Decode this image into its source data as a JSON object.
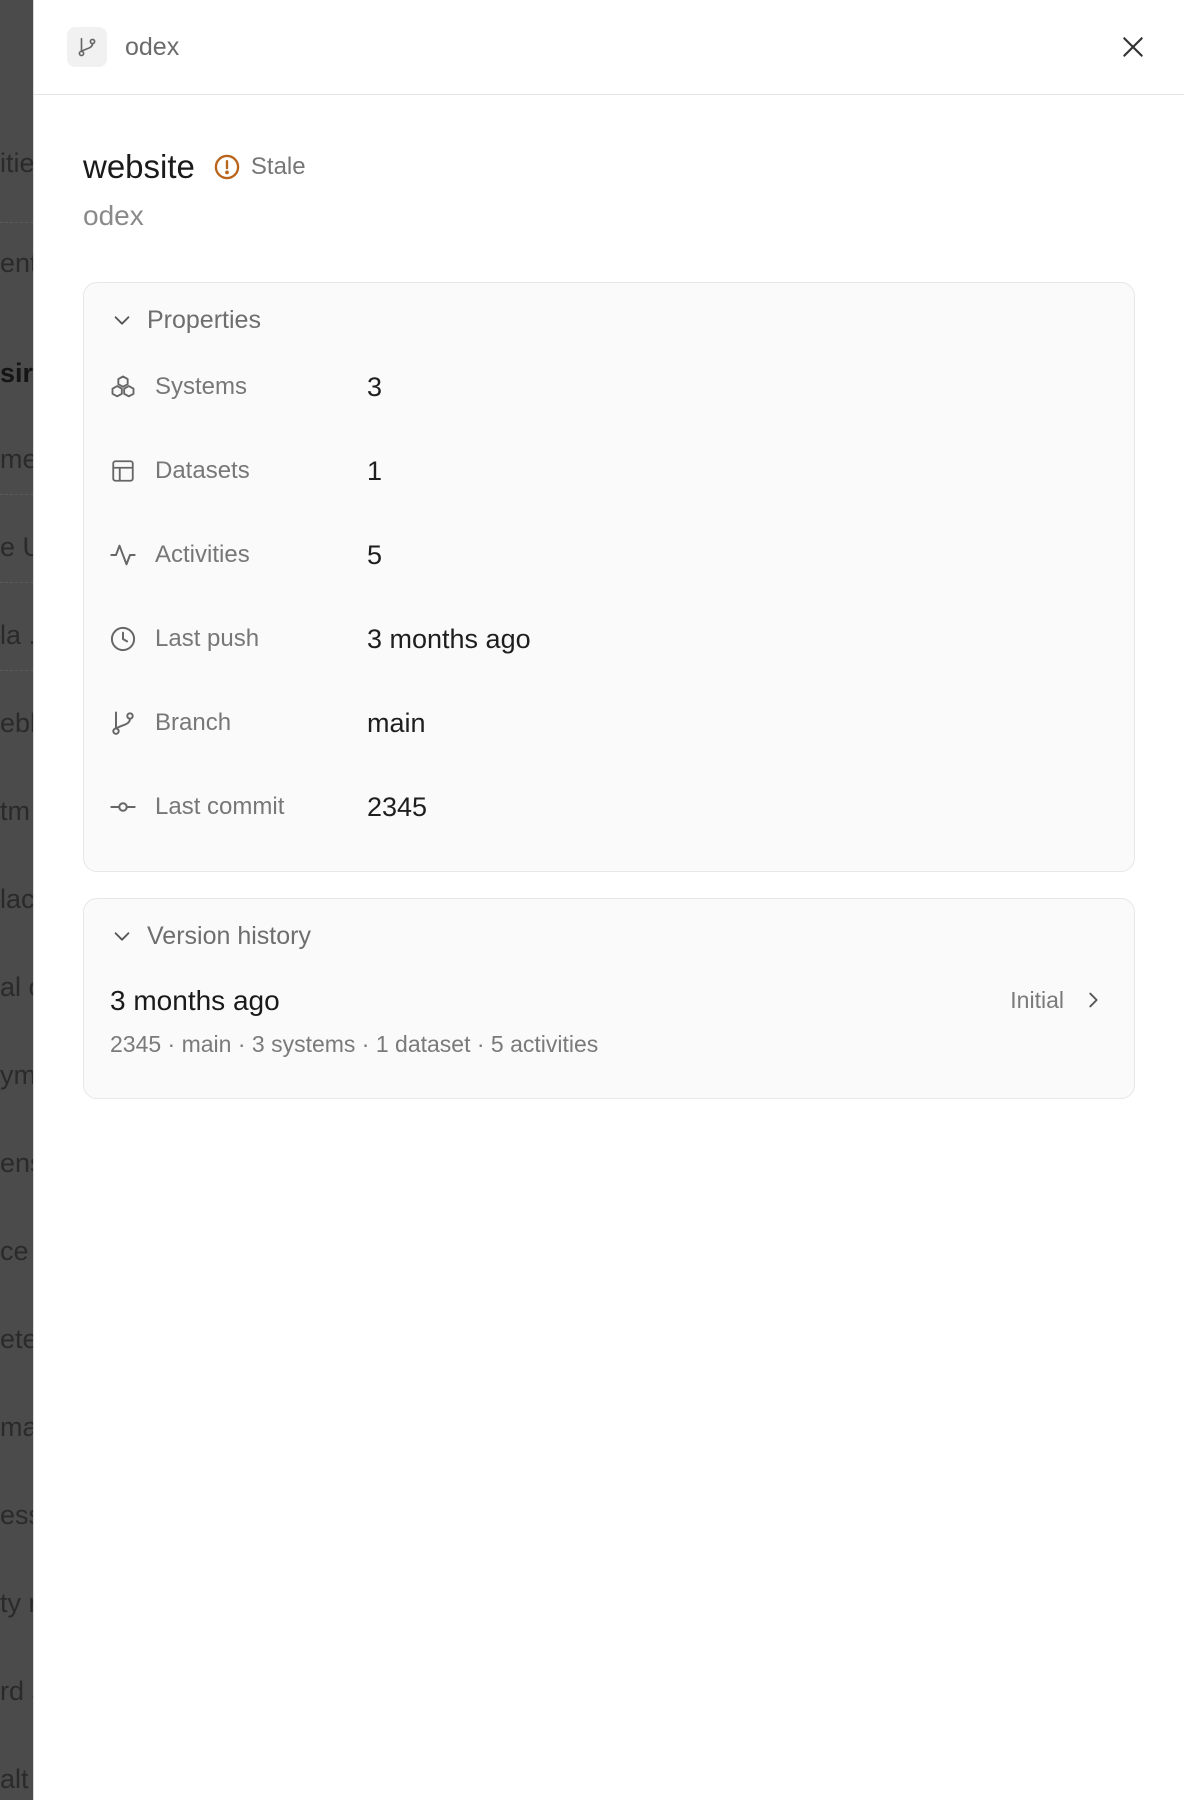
{
  "backdrop": {
    "fragments": [
      "itie",
      "ent",
      "sir",
      "me",
      "e U",
      "la .",
      "ebl",
      "tm",
      "lac",
      "al c",
      "ym",
      "ens",
      "ce",
      "ete",
      "ma",
      "ess",
      "ty r",
      "rd s",
      "alt"
    ]
  },
  "topbar": {
    "title": "odex",
    "repo_icon": "git-branch-icon",
    "close_icon": "close-icon"
  },
  "entity": {
    "name": "website",
    "status_label": "Stale",
    "status_color": "#b8641a",
    "subtitle": "odex"
  },
  "properties": {
    "section_label": "Properties",
    "rows": [
      {
        "icon": "systems-icon",
        "key": "Systems",
        "value": "3"
      },
      {
        "icon": "dataset-table-icon",
        "key": "Datasets",
        "value": "1"
      },
      {
        "icon": "activity-pulse-icon",
        "key": "Activities",
        "value": "5"
      },
      {
        "icon": "clock-icon",
        "key": "Last push",
        "value": "3 months ago"
      },
      {
        "icon": "git-branch-icon",
        "key": "Branch",
        "value": "main"
      },
      {
        "icon": "git-commit-icon",
        "key": "Last commit",
        "value": "2345"
      }
    ]
  },
  "version_history": {
    "section_label": "Version history",
    "items": [
      {
        "title": "3 months ago",
        "meta": "2345 · main · 3 systems · 1 dataset · 5 activities",
        "tag": "Initial"
      }
    ]
  }
}
